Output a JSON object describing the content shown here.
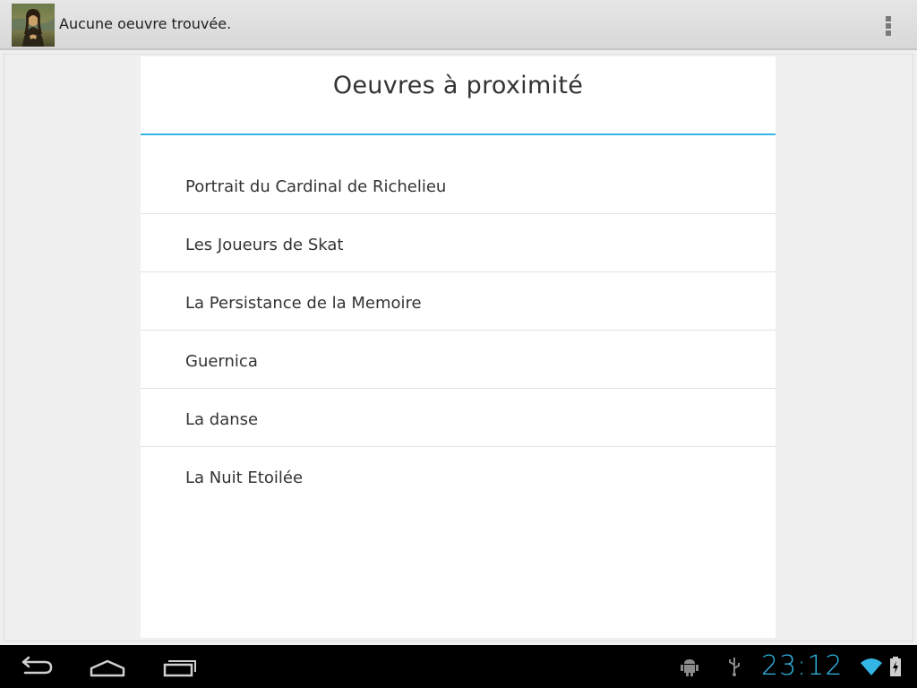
{
  "action_bar": {
    "app_icon": "mona-lisa-icon",
    "title": "Aucune oeuvre trouvée.",
    "overflow_icon": "overflow-menu-icon"
  },
  "panel": {
    "title": "Oeuvres à proximité",
    "accent_color": "#33b5e5",
    "items": [
      {
        "label": "Portrait du Cardinal de Richelieu"
      },
      {
        "label": "Les Joueurs de Skat"
      },
      {
        "label": "La Persistance de la Memoire"
      },
      {
        "label": "Guernica"
      },
      {
        "label": "La danse"
      },
      {
        "label": "La Nuit Etoilée"
      }
    ]
  },
  "system_bar": {
    "buttons": [
      "back-icon",
      "home-icon",
      "recent-apps-icon"
    ],
    "status_icons": [
      "android-debug-icon",
      "usb-icon",
      "wifi-icon",
      "battery-charging-icon"
    ],
    "clock": "23:12",
    "clock_color": "#33b5e5"
  }
}
